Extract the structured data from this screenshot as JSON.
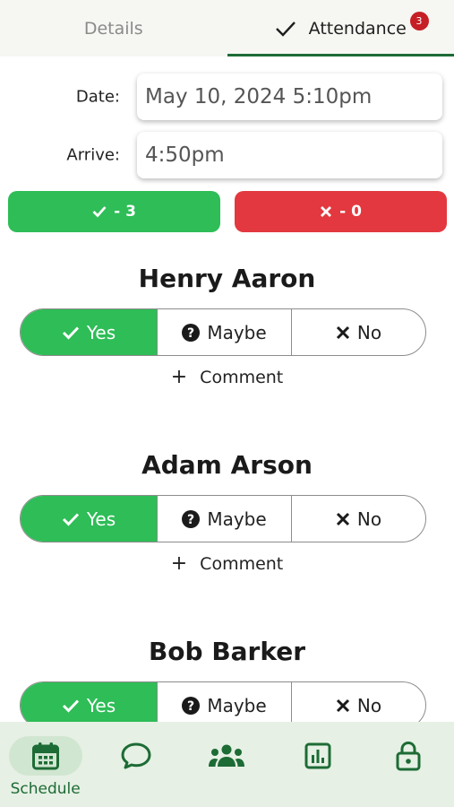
{
  "tabs": [
    {
      "label": "Details",
      "active": false
    },
    {
      "label": "Attendance",
      "active": true,
      "badge": "3"
    }
  ],
  "form": {
    "date_label": "Date:",
    "date_value": "May 10, 2024 5:10pm",
    "arrive_label": "Arrive:",
    "arrive_value": "4:50pm"
  },
  "summary": {
    "yes_label": "- 3",
    "no_label": "- 0"
  },
  "players": [
    {
      "name": "Henry Aaron",
      "status": "Yes",
      "comment_label": "Comment"
    },
    {
      "name": "Adam Arson",
      "status": "Yes",
      "comment_label": "Comment"
    },
    {
      "name": "Bob Barker",
      "status": "Yes",
      "comment_label": "Comment"
    }
  ],
  "rsvp_options": {
    "yes": "Yes",
    "maybe": "Maybe",
    "no": "No"
  },
  "bottom_nav": [
    {
      "icon": "calendar-icon",
      "label": "Schedule",
      "active": true
    },
    {
      "icon": "chat-icon",
      "label": "",
      "active": false
    },
    {
      "icon": "team-icon",
      "label": "",
      "active": false
    },
    {
      "icon": "stats-icon",
      "label": "",
      "active": false
    },
    {
      "icon": "lock-icon",
      "label": "",
      "active": false
    }
  ],
  "colors": {
    "yes_green": "#2ebd57",
    "no_red": "#e3383f",
    "brand_green": "#1d6b35",
    "badge_red": "#c61f26"
  }
}
